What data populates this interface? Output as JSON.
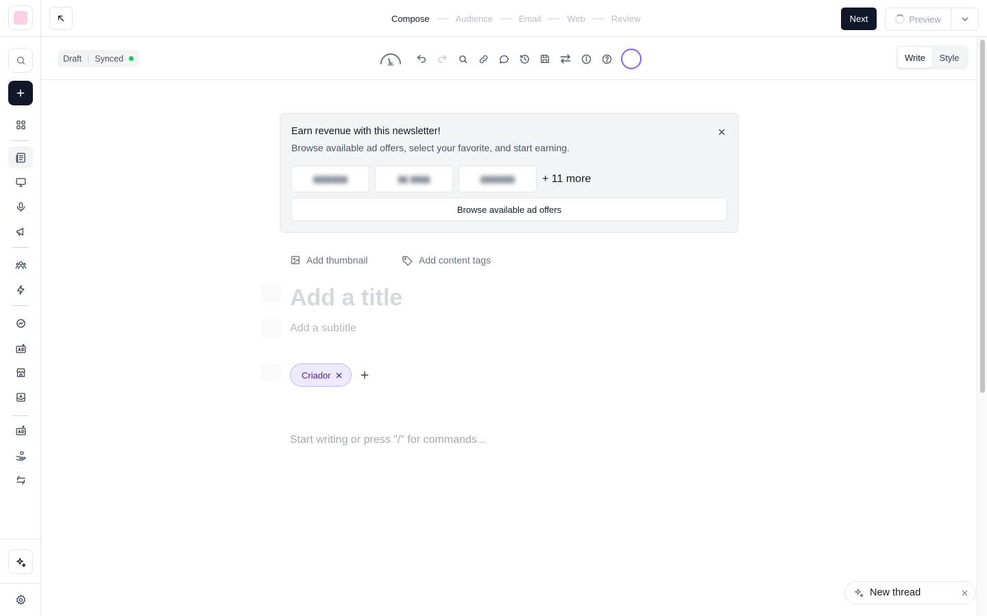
{
  "app": {
    "brand_color": "#fbcfe8",
    "accent_color": "#8b5cf6"
  },
  "sidebar": {
    "items": [
      {
        "name": "search-icon",
        "interactable": true
      },
      {
        "name": "plus-icon",
        "interactable": true
      },
      {
        "name": "grid-icon"
      },
      {
        "name": "posts-icon",
        "active": true
      },
      {
        "name": "monitor-icon"
      },
      {
        "name": "microphone-icon"
      },
      {
        "name": "megaphone-icon"
      },
      {
        "name": "users-icon"
      },
      {
        "name": "lightning-icon"
      },
      {
        "name": "growth-icon"
      },
      {
        "name": "ads-icon"
      },
      {
        "name": "storefront-icon"
      },
      {
        "name": "inbox-icon"
      },
      {
        "name": "ads-upload-icon"
      },
      {
        "name": "hand-coin-icon"
      },
      {
        "name": "swap-icon"
      },
      {
        "name": "sparkles-icon"
      },
      {
        "name": "gear-icon"
      }
    ]
  },
  "header": {
    "steps": [
      "Compose",
      "Audience",
      "Email",
      "Web",
      "Review"
    ],
    "active_step": "Compose",
    "next_label": "Next",
    "preview_label": "Preview"
  },
  "toolbar": {
    "status_draft": "Draft",
    "status_synced": "Synced",
    "synced_color": "#22c55e",
    "tools": [
      "gauge-icon",
      "undo-icon",
      "redo-icon",
      "search-icon",
      "link-icon",
      "comment-icon",
      "history-icon",
      "save-icon",
      "swap-icon",
      "info-icon",
      "help-icon"
    ],
    "mode_write": "Write",
    "mode_style": "Style",
    "active_mode": "Write"
  },
  "banner": {
    "title": "Earn revenue with this newsletter!",
    "subtitle": "Browse available ad offers, select your favorite, and start earning.",
    "more_count": "+ 11 more",
    "browse_label": "Browse available ad offers"
  },
  "post": {
    "add_thumbnail": "Add thumbnail",
    "add_tags": "Add content tags",
    "title_placeholder": "Add a title",
    "subtitle_placeholder": "Add a subtitle",
    "author": "Criador",
    "body_placeholder": "Start writing or press \"/\" for commands..."
  },
  "thread": {
    "label": "New thread"
  }
}
